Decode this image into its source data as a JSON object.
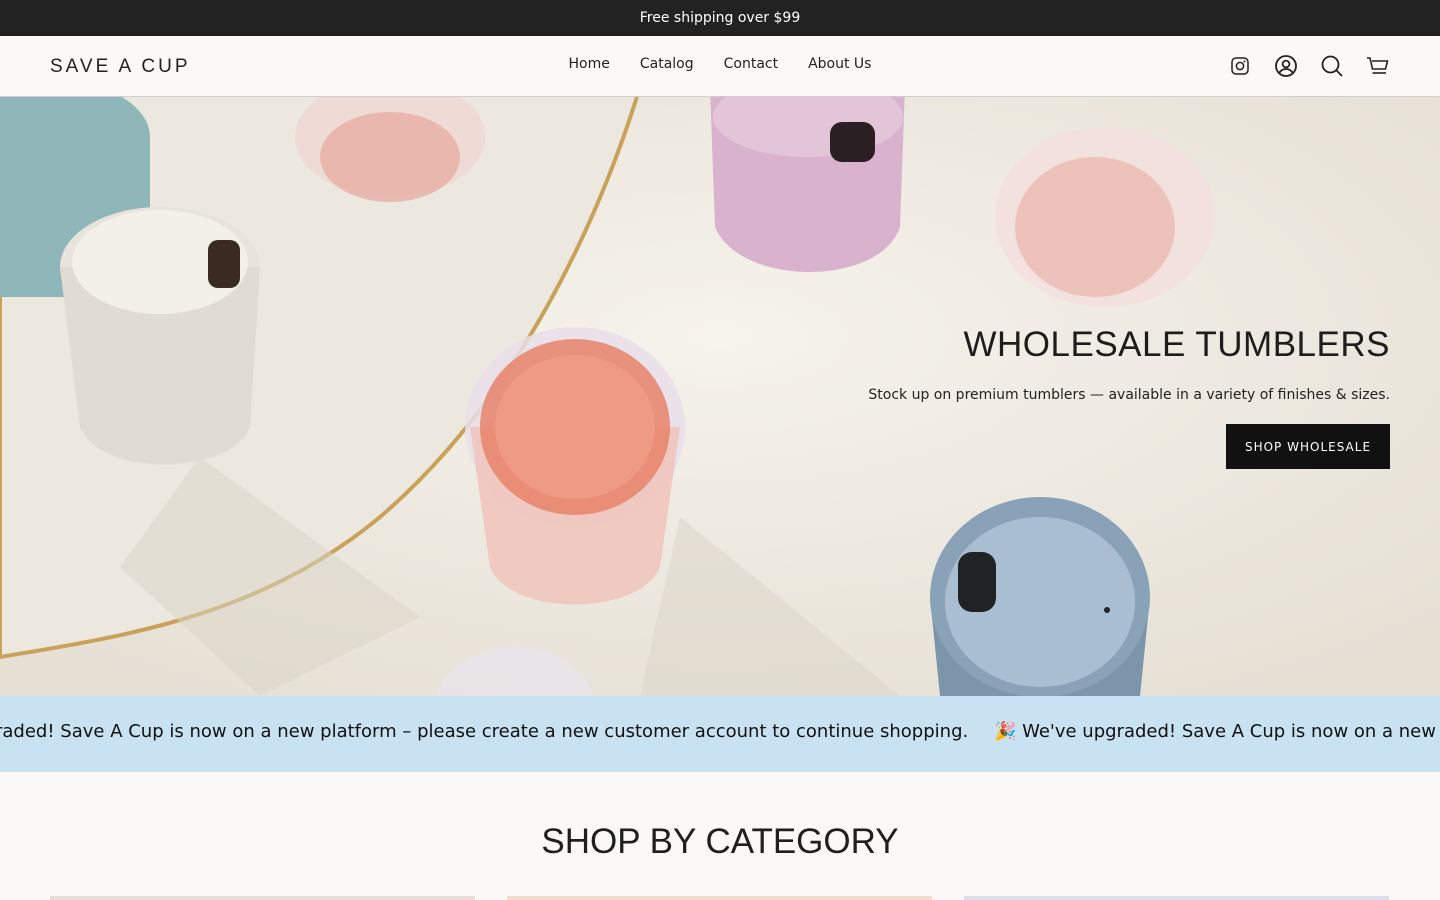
{
  "announcement": {
    "text": "Free shipping over $99"
  },
  "header": {
    "logo": "SAVE A CUP",
    "nav": [
      "Home",
      "Catalog",
      "Contact",
      "About Us"
    ],
    "icons": [
      "instagram-icon",
      "account-icon",
      "search-icon",
      "cart-icon"
    ]
  },
  "hero": {
    "title": "WHOLESALE TUMBLERS",
    "subtitle": "Stock up on premium tumblers — available in a variety of finishes & sizes.",
    "button": "SHOP WHOLESALE"
  },
  "marquee": {
    "items": [
      "raded! Save A Cup is now on a new platform – please create a new customer account to continue shopping.",
      "🎉 We've upgraded! Save A Cup is now on a new platform – ple"
    ]
  },
  "section": {
    "title": "SHOP BY CATEGORY"
  },
  "colors": {
    "announcement_bg": "#222222",
    "marquee_bg": "#c9e2f2",
    "button_bg": "#111111"
  }
}
